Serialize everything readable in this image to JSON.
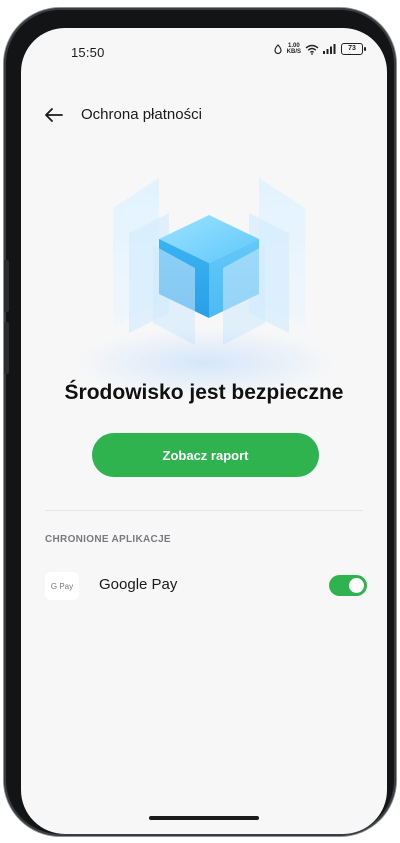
{
  "status_bar": {
    "time": "15:50",
    "net_speed_value": "1.00",
    "net_speed_unit": "KB/S",
    "battery": "73",
    "icons": [
      "alarm-icon",
      "wifi-icon",
      "signal-icon",
      "battery-icon"
    ]
  },
  "header": {
    "back_icon": "arrow-left-icon",
    "title": "Ochrona płatności"
  },
  "main": {
    "heading": "Środowisko jest bezpieczne",
    "report_button": "Zobacz raport"
  },
  "protected_apps": {
    "label": "CHRONIONE APLIKACJE",
    "items": [
      {
        "icon_text": "G Pay",
        "name": "Google Pay",
        "enabled": true
      }
    ]
  },
  "colors": {
    "accent": "#2fb34f",
    "background": "#f7f7f8",
    "cube": "#3fb8f5"
  }
}
